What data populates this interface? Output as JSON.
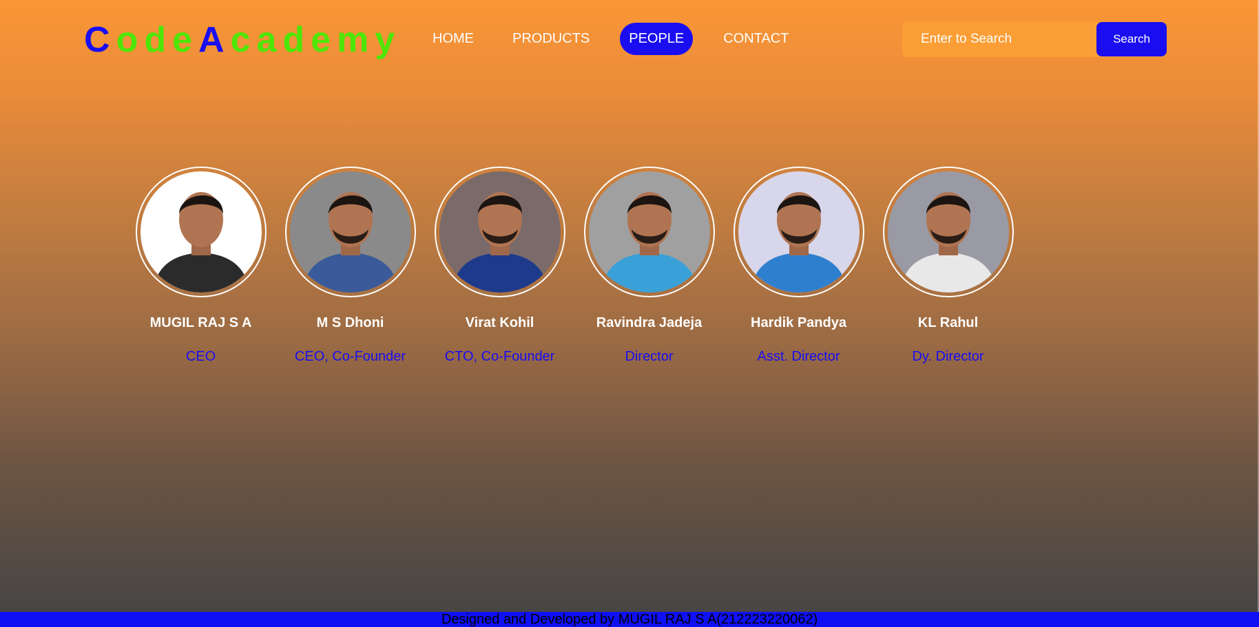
{
  "brand": {
    "letters": [
      {
        "char": "C",
        "color": "#1a0ef0"
      },
      {
        "char": "o",
        "color": "#4ee608"
      },
      {
        "char": "d",
        "color": "#4ee608"
      },
      {
        "char": "e",
        "color": "#4ee608"
      },
      {
        "char": "A",
        "color": "#1a0ef0"
      },
      {
        "char": "c",
        "color": "#4ee608"
      },
      {
        "char": "a",
        "color": "#4ee608"
      },
      {
        "char": "d",
        "color": "#4ee608"
      },
      {
        "char": "e",
        "color": "#4ee608"
      },
      {
        "char": "m",
        "color": "#4ee608"
      },
      {
        "char": "y",
        "color": "#4ee608"
      }
    ]
  },
  "nav": {
    "items": [
      {
        "label": "HOME",
        "active": false
      },
      {
        "label": "PRODUCTS",
        "active": false
      },
      {
        "label": "PEOPLE",
        "active": true
      },
      {
        "label": "CONTACT",
        "active": false
      }
    ]
  },
  "search": {
    "placeholder": "Enter to Search",
    "button_label": "Search"
  },
  "people": [
    {
      "name": "MUGIL RAJ S A",
      "role": "CEO",
      "icon": "person-photo-suit-icon",
      "bg": "#ffffff",
      "shirt": "#2b2b2b"
    },
    {
      "name": "M S Dhoni",
      "role": "CEO, Co-Founder",
      "icon": "person-photo-jersey-icon",
      "bg": "#8a8a8a",
      "shirt": "#3a5a9a"
    },
    {
      "name": "Virat Kohil",
      "role": "CTO, Co-Founder",
      "icon": "person-photo-jersey-icon",
      "bg": "#7a6a6a",
      "shirt": "#1e3a8a"
    },
    {
      "name": "Ravindra Jadeja",
      "role": "Director",
      "icon": "person-photo-jersey-icon",
      "bg": "#a0a0a0",
      "shirt": "#3aa0d8"
    },
    {
      "name": "Hardik Pandya",
      "role": "Asst. Director",
      "icon": "person-photo-jersey-icon",
      "bg": "#d8d6ea",
      "shirt": "#2f7fcf"
    },
    {
      "name": "KL Rahul",
      "role": "Dy. Director",
      "icon": "person-photo-jersey-icon",
      "bg": "#9a9aa4",
      "shirt": "#e8e8e8"
    }
  ],
  "footer": {
    "text": "Designed and Developed by MUGIL RAJ S A(212223220062)"
  },
  "colors": {
    "accent": "#1a0ef0",
    "brand_green": "#4ee608",
    "search_bg": "#fb9e35",
    "footer_bg": "#1010f5"
  }
}
